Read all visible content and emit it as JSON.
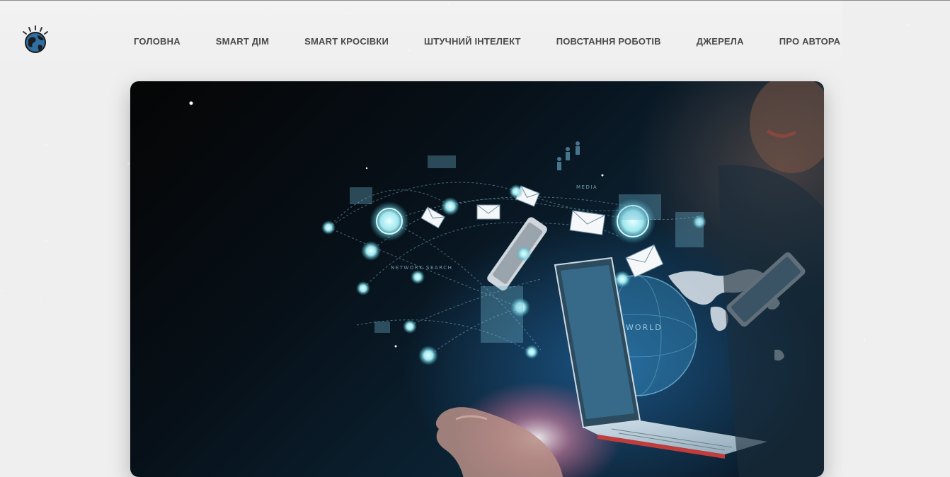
{
  "nav": {
    "items": [
      {
        "label": "ГОЛОВНА"
      },
      {
        "label": "SMART ДІМ"
      },
      {
        "label": "SMART КРОСІВКИ"
      },
      {
        "label": "ШТУЧНИЙ ІНТЕЛЕКТ"
      },
      {
        "label": "ПОВСТАННЯ РОБОТІВ"
      },
      {
        "label": "ДЖЕРЕЛА"
      },
      {
        "label": "ПРО АВТОРА"
      }
    ]
  },
  "logo": {
    "icon": "globe-icon"
  },
  "hero": {
    "image": "technology-network-hand-laptop",
    "labels": {
      "media": "MEDIA",
      "world": "WORLD",
      "network_search": "NETWORK SEARCH"
    }
  },
  "colors": {
    "background": "#efefef",
    "nav_text": "#4a4a4a",
    "hero_glow": "#2a8fd0"
  }
}
